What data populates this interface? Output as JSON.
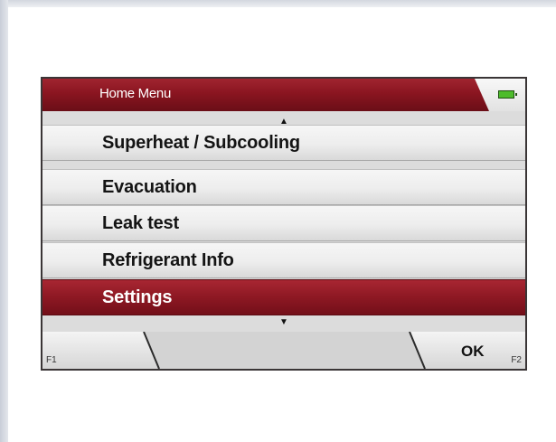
{
  "title": "Home Menu",
  "icons": {
    "up": "▲",
    "down": "▼",
    "battery": "battery-full-icon"
  },
  "menu": {
    "items": [
      {
        "label": "Superheat / Subcooling",
        "selected": false
      },
      {
        "label": "Evacuation",
        "selected": false
      },
      {
        "label": "Leak test",
        "selected": false
      },
      {
        "label": "Refrigerant Info",
        "selected": false
      },
      {
        "label": "Settings",
        "selected": true
      }
    ]
  },
  "softkeys": {
    "f1": "F1",
    "f2": "F2",
    "right_label": "OK"
  },
  "colors": {
    "accent": "#8d1823",
    "battery": "#4dbc2b"
  }
}
